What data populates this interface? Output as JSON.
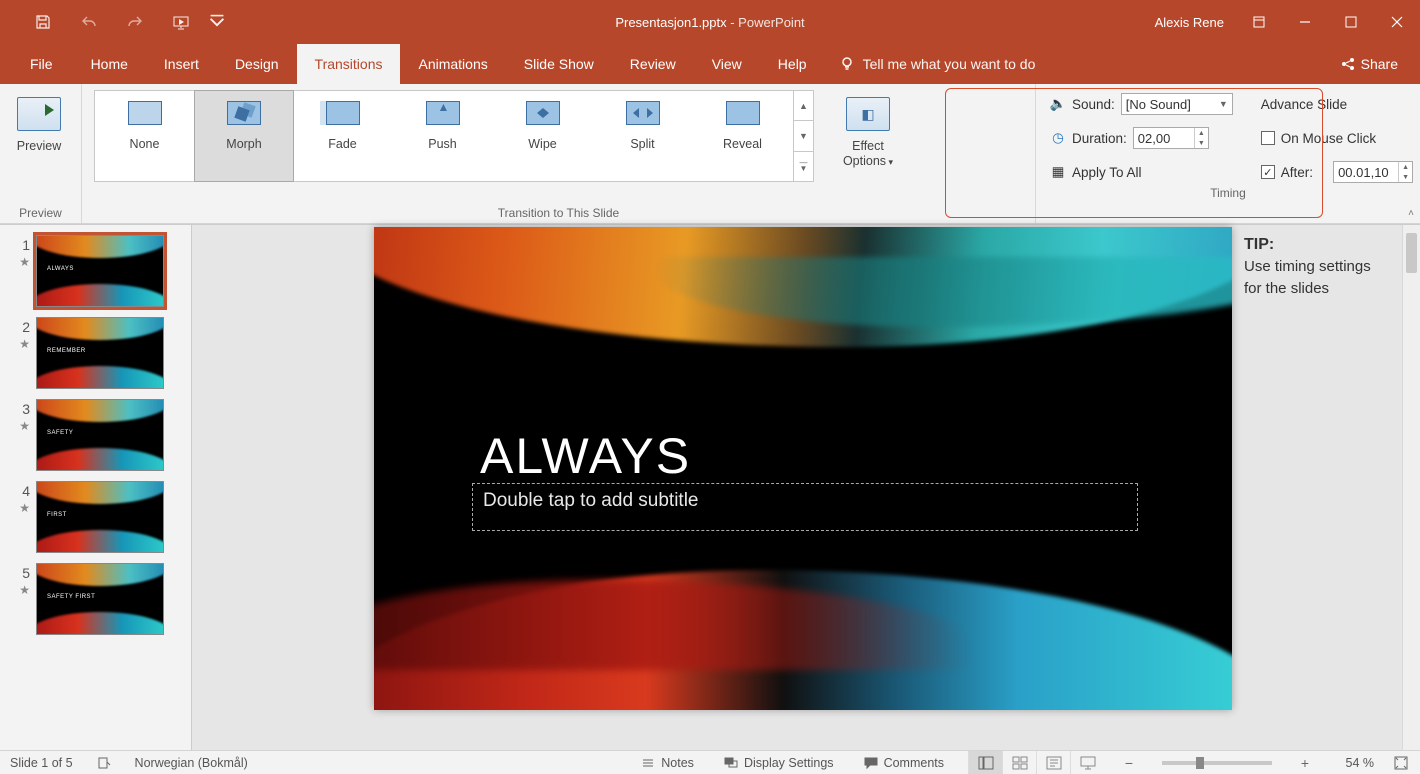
{
  "window": {
    "filename": "Presentasjon1.pptx",
    "app_suffix": "  -  PowerPoint",
    "user": "Alexis Rene"
  },
  "tabs": {
    "file": "File",
    "items": [
      "Home",
      "Insert",
      "Design",
      "Transitions",
      "Animations",
      "Slide Show",
      "Review",
      "View",
      "Help"
    ],
    "active_index": 3,
    "tellme": "Tell me what you want to do",
    "share": "Share"
  },
  "ribbon": {
    "preview": {
      "label": "Preview",
      "group_label": "Preview"
    },
    "transitions": {
      "group_label": "Transition to This Slide",
      "items": [
        "None",
        "Morph",
        "Fade",
        "Push",
        "Wipe",
        "Split",
        "Reveal"
      ],
      "selected_index": 1,
      "effect_options": "Effect Options"
    },
    "timing": {
      "group_label": "Timing",
      "sound_label": "Sound:",
      "sound_value": "[No Sound]",
      "duration_label": "Duration:",
      "duration_value": "02,00",
      "apply_all": "Apply To All",
      "advance_header": "Advance Slide",
      "on_mouse": "On Mouse Click",
      "on_mouse_checked": false,
      "after_label": "After:",
      "after_checked": true,
      "after_value": "00.01,10"
    }
  },
  "thumbnails": [
    {
      "num": "1",
      "text": "ALWAYS"
    },
    {
      "num": "2",
      "text": "REMEMBER"
    },
    {
      "num": "3",
      "text": "SAFETY"
    },
    {
      "num": "4",
      "text": "FIRST"
    },
    {
      "num": "5",
      "text": "SAFETY FIRST"
    }
  ],
  "slide": {
    "title": "ALWAYS",
    "subtitle_placeholder": "Double tap to add subtitle"
  },
  "tip": {
    "heading": "TIP:",
    "body": "Use timing settings for the slides"
  },
  "status": {
    "slide_info": "Slide 1 of 5",
    "language": "Norwegian (Bokmål)",
    "notes": "Notes",
    "display_settings": "Display Settings",
    "comments": "Comments",
    "zoom_pct": "54 %"
  }
}
